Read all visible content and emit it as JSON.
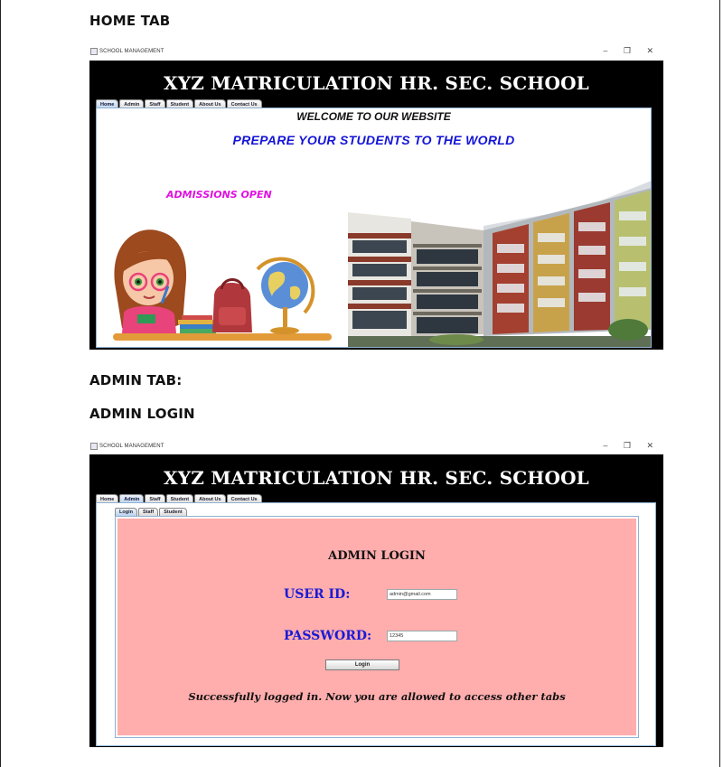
{
  "headings": {
    "home_tab": "HOME TAB",
    "admin_tab": "ADMIN TAB:",
    "admin_login": "ADMIN LOGIN"
  },
  "window": {
    "title": "SCHOOL MANAGEMENT",
    "school_name": "XYZ MATRICULATION HR. SEC. SCHOOL",
    "controls": {
      "minimize": "–",
      "restore": "❐",
      "close": "✕"
    },
    "tabs": [
      "Home",
      "Admin",
      "Staff",
      "Student",
      "About Us",
      "Contact Us"
    ]
  },
  "home": {
    "active_tab": "Home",
    "welcome": "WELCOME TO OUR WEBSITE",
    "tagline": "PREPARE YOUR STUDENTS TO THE WORLD",
    "admissions": "ADMISSIONS OPEN",
    "illustration": "girl-with-books-and-globe-image",
    "photo": "school-building-image"
  },
  "admin": {
    "active_tab": "Admin",
    "subtabs": [
      "Login",
      "Staff",
      "Student"
    ],
    "active_subtab": "Login",
    "heading": "ADMIN LOGIN",
    "user_id_label": "USER ID:",
    "user_id_value": "admin@gmail.com",
    "password_label": "PASSWORD:",
    "password_value": "12345",
    "login_button": "Login",
    "message": "Successfully logged in. Now you are allowed to access other tabs"
  },
  "colors": {
    "title_bar": "#000000",
    "tagline": "#1414d8",
    "admissions": "#e012e0",
    "login_panel": "#ffadad",
    "field_label": "#1a1ad6"
  }
}
